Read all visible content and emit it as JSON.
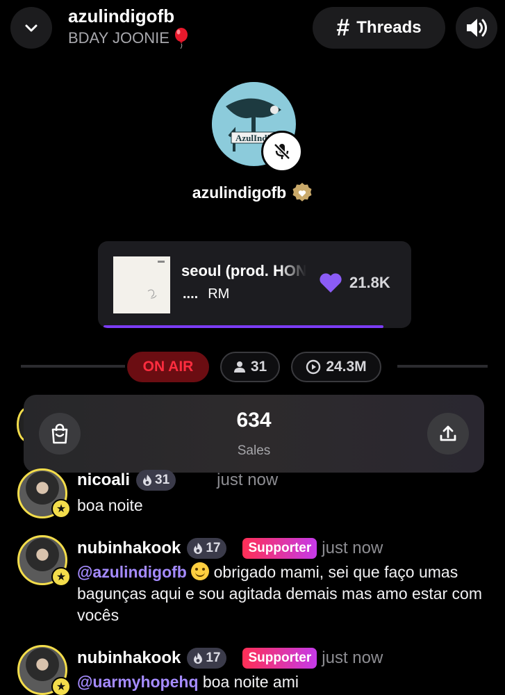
{
  "header": {
    "room_title": "azulindigofb",
    "room_subtitle": "BDAY JOONIE",
    "threads_label": "Threads",
    "threads_hash": "#"
  },
  "host": {
    "name": "azulindigofb",
    "avatar_text": "AzulIndigo"
  },
  "now_playing": {
    "title": "seoul (prod. HONNE)",
    "artist_prefix": "....",
    "artist": "RM",
    "likes": "21.8K",
    "progress": 0.91,
    "accent_color": "#7b3cf5"
  },
  "status": {
    "on_air": "ON AIR",
    "listeners": "31",
    "plays": "24.3M"
  },
  "sales": {
    "count": "634",
    "label": "Sales"
  },
  "chat": [
    {
      "username": "nicoali",
      "level": "31",
      "supporter": "",
      "time": "just now",
      "mention": "",
      "text": "boa noite"
    },
    {
      "username": "nubinhakook",
      "level": "17",
      "supporter": "Supporter",
      "time": "just now",
      "mention": "@azulindigofb",
      "text": "obrigado mami, sei que faço umas bagunças aqui e sou agitada demais mas amo estar com vocês"
    },
    {
      "username": "nubinhakook",
      "level": "17",
      "supporter": "Supporter",
      "time": "just now",
      "mention": "@uarmyhopehq",
      "text": "boa noite ami"
    }
  ],
  "icons": {
    "collapse": "chevron-down-icon",
    "threads": "hash-icon",
    "sound": "speaker-icon",
    "mute": "mic-off-icon",
    "verified": "verified-badge-icon",
    "like": "heart-icon",
    "listeners": "person-icon",
    "plays": "play-circle-icon",
    "sales": "shopping-bag-icon",
    "share": "share-icon",
    "level": "flame-icon",
    "rank": "star-icon"
  },
  "colors": {
    "on_air_bg": "#6b0d12",
    "on_air_text": "#ff2d3f",
    "mention": "#a58bff",
    "avatar_ring": "#f3dd4b",
    "supporter_start": "#ff2f55",
    "supporter_end": "#c53ae9"
  }
}
